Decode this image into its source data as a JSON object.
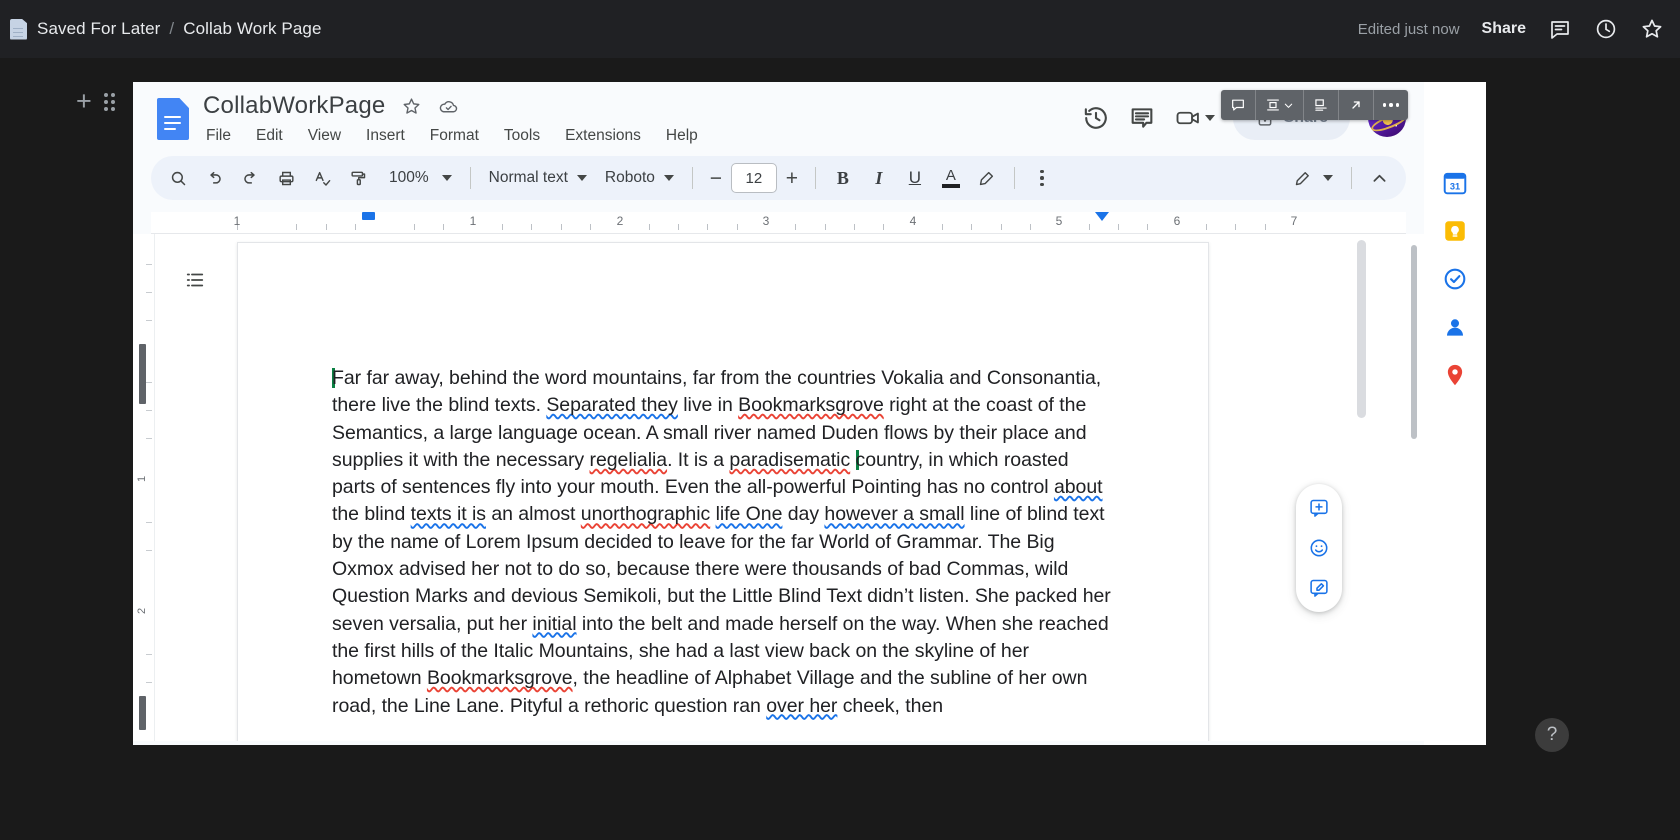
{
  "os_bar": {
    "doc_icon": "document-icon",
    "breadcrumb_parent": "Saved For Later",
    "breadcrumb_sep": "/",
    "breadcrumb_current": "Collab Work Page",
    "edited_status": "Edited just now",
    "share_label": "Share",
    "icons": [
      "comment-icon",
      "history-clock-icon",
      "star-icon"
    ]
  },
  "docs": {
    "logo": "google-docs-logo",
    "title": "CollabWorkPage",
    "star_icon": "star-outline-icon",
    "cloud_icon": "cloud-saved-icon",
    "menus": [
      "File",
      "Edit",
      "View",
      "Insert",
      "Format",
      "Tools",
      "Extensions",
      "Help"
    ],
    "header_icons": [
      "version-history-icon",
      "comment-history-icon",
      "meet-camera-icon"
    ],
    "share_button": {
      "label": "Share",
      "lock_icon": "lock-icon"
    },
    "avatar": "user-avatar"
  },
  "overlay_toolbar": {
    "buttons": [
      {
        "name": "add-comment-icon",
        "label": "Comment"
      },
      {
        "name": "image-position-icon",
        "label": "Position",
        "has_chevron": true
      },
      {
        "name": "text-wrap-icon",
        "label": "Wrap text"
      },
      {
        "name": "expand-arrow-icon",
        "label": "Open"
      },
      {
        "name": "more-options-icon",
        "label": "More options"
      }
    ]
  },
  "toolbar": {
    "search_icon": "search-icon",
    "undo_icon": "undo-icon",
    "redo_icon": "redo-icon",
    "print_icon": "print-icon",
    "spellcheck_icon": "spellcheck-icon",
    "paint_format_icon": "paint-format-icon",
    "zoom_value": "100%",
    "style_value": "Normal text",
    "font_value": "Roboto",
    "font_decrease": "−",
    "font_size": "12",
    "font_increase": "+",
    "bold": "B",
    "italic": "I",
    "underline": "U",
    "text_color": "A",
    "highlight_icon": "highlight-pen-icon",
    "more_icon": "more-vertical-icon",
    "edit_mode_icon": "edit-pencil-icon",
    "collapse_icon": "chevron-up-icon"
  },
  "ruler": {
    "numbers": [
      "1",
      "1",
      "2",
      "3",
      "4",
      "5",
      "6",
      "7"
    ],
    "left_indent_marker": "left-indent-marker",
    "right_indent_marker": "right-indent-marker"
  },
  "vertical_ruler": {
    "numbers": [
      "1",
      "2"
    ]
  },
  "document": {
    "outline_icon": "document-outline-icon",
    "paragraphs": [
      [
        {
          "t": "caret",
          "v": ""
        },
        {
          "t": "plain",
          "v": "Far far away, behind the word mountains, far from the countries Vokalia and Consonantia, there live the blind texts. "
        },
        {
          "t": "blue",
          "v": "Separated they"
        },
        {
          "t": "plain",
          "v": " live in "
        },
        {
          "t": "red",
          "v": "Bookmarksgrove"
        },
        {
          "t": "plain",
          "v": " right at the coast of the Semantics, a large language ocean. A small river named Duden flows by their place and supplies it with the necessary "
        },
        {
          "t": "red",
          "v": "regelialia"
        },
        {
          "t": "plain",
          "v": ". It is a "
        },
        {
          "t": "red",
          "v": "paradisematic"
        },
        {
          "t": "plain",
          "v": " "
        },
        {
          "t": "caret",
          "v": ""
        },
        {
          "t": "plain",
          "v": "country, in which roasted parts of sentences fly into your mouth. Even the all-powerful Pointing has no control "
        },
        {
          "t": "blue",
          "v": "about"
        },
        {
          "t": "plain",
          "v": " the blind "
        },
        {
          "t": "blue",
          "v": "texts it is"
        },
        {
          "t": "plain",
          "v": " an almost "
        },
        {
          "t": "red",
          "v": "unorthographic"
        },
        {
          "t": "plain",
          "v": " "
        },
        {
          "t": "blue",
          "v": "life One"
        },
        {
          "t": "plain",
          "v": " day "
        },
        {
          "t": "blue",
          "v": "however a small"
        },
        {
          "t": "plain",
          "v": " line of blind text by the name of Lorem Ipsum decided to leave for the far World of Grammar. The Big Oxmox advised her not to do so, because there were thousands of bad Commas, wild Question Marks and devious Semikoli, but the Little Blind Text didn’t listen. She packed her seven versalia, put her "
        },
        {
          "t": "blue",
          "v": "initial"
        },
        {
          "t": "plain",
          "v": " into the belt and made herself on the way. When she reached the first hills of the Italic Mountains, she had a last view back on the skyline of her hometown "
        },
        {
          "t": "red",
          "v": "Bookmarksgrove"
        },
        {
          "t": "plain",
          "v": ", the headline of Alphabet Village and the subline of her own road, the Line Lane. Pityful a rethoric question ran "
        },
        {
          "t": "blue",
          "v": "over her"
        },
        {
          "t": "plain",
          "v": " cheek, then"
        }
      ]
    ]
  },
  "comment_rail": {
    "buttons": [
      {
        "name": "add-comment-rail-icon",
        "label": "Add comment"
      },
      {
        "name": "add-emoji-reaction-icon",
        "label": "Add emoji reaction"
      },
      {
        "name": "suggest-edit-icon",
        "label": "Suggest edits"
      }
    ]
  },
  "side_rail": {
    "items": [
      {
        "name": "google-calendar-icon",
        "label": "Calendar",
        "color": "#1a73e8"
      },
      {
        "name": "google-keep-icon",
        "label": "Keep",
        "color": "#fbbc04"
      },
      {
        "name": "google-tasks-icon",
        "label": "Tasks",
        "color": "#1a73e8"
      },
      {
        "name": "google-contacts-icon",
        "label": "Contacts",
        "color": "#1a73e8"
      },
      {
        "name": "google-maps-icon",
        "label": "Maps",
        "color": "#ea4335"
      }
    ],
    "help_label": "?"
  },
  "colors": {
    "accent": "#1a73e8",
    "spelling_error": "#ea4335",
    "grammar_error": "#1a73e8",
    "toolbar_bg": "#edf2fa",
    "os_bar_bg": "#202124",
    "cursor": "#0b8043"
  }
}
